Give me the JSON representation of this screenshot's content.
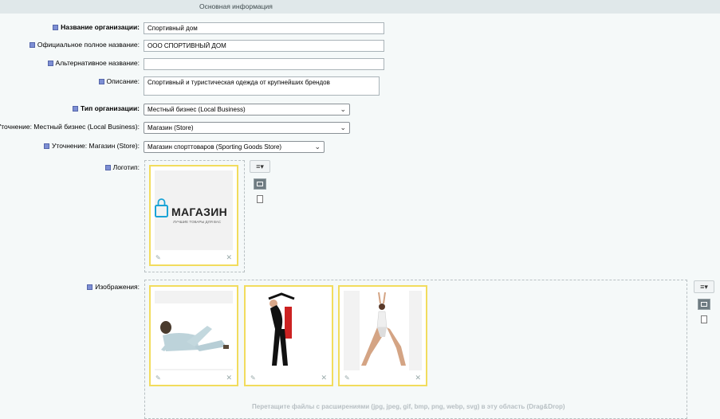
{
  "header": {
    "title": "Основная информация"
  },
  "fields": {
    "org_name": {
      "label": "Название организации:",
      "value": "Спортивный дом"
    },
    "full_name": {
      "label": "Официальное полное название:",
      "value": "ООО СПОРТИВНЫЙ ДОМ"
    },
    "alt_name": {
      "label": "Альтернативное название:",
      "value": ""
    },
    "description": {
      "label": "Описание:",
      "value": "Спортивный и туристическая одежда от крупнейших брендов"
    },
    "org_type": {
      "label": "Тип организации:",
      "value": "Местный бизнес (Local Business)"
    },
    "spec1": {
      "label": "Уточнение: Местный бизнес (Local Business):",
      "value": "Магазин (Store)"
    },
    "spec2": {
      "label": "Уточнение: Магазин (Store):",
      "value": "Магазин спорттоваров (Sporting Goods Store)"
    },
    "logo": {
      "label": "Логотип:",
      "brand": "МАГАЗИН",
      "tagline": "ЛУЧШИЕ ТОВАРЫ ДЛЯ ВАС"
    },
    "images": {
      "label": "Изображения:"
    }
  },
  "dropzone_text": "Перетащите файлы с расширениями (jpg, jpeg, gif, bmp, png, webp, svg) в эту область (Drag&Drop)",
  "icons": {
    "menu": "≡▾",
    "pencil": "✎",
    "close": "✕",
    "chevron": "⌄"
  },
  "colors": {
    "accent_border": "#f2dc5d",
    "label_square": "#7d8fd4"
  }
}
